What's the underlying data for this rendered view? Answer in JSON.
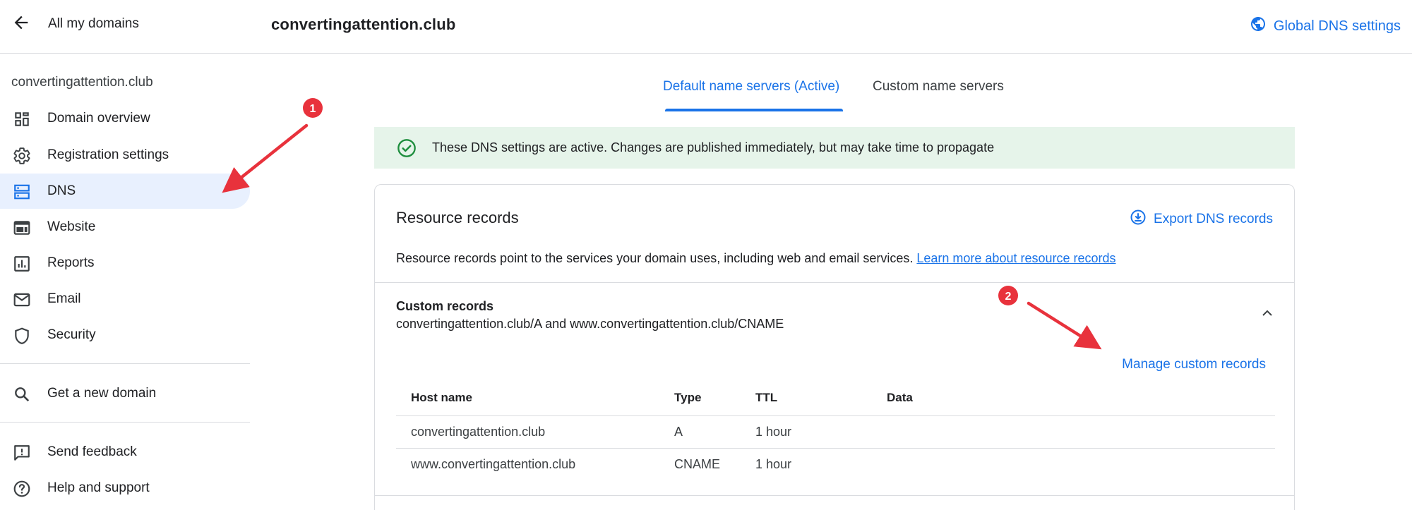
{
  "header": {
    "back_label": "All my domains",
    "domain": "convertingattention.club",
    "global_dns_label": "Global DNS settings"
  },
  "sidebar": {
    "domain": "convertingattention.club",
    "items": [
      {
        "label": "Domain overview",
        "icon": "dashboard-icon"
      },
      {
        "label": "Registration settings",
        "icon": "gear-icon"
      },
      {
        "label": "DNS",
        "icon": "dns-icon",
        "active": true
      },
      {
        "label": "Website",
        "icon": "web-icon"
      },
      {
        "label": "Reports",
        "icon": "bar-chart-icon"
      },
      {
        "label": "Email",
        "icon": "mail-icon"
      },
      {
        "label": "Security",
        "icon": "shield-icon"
      }
    ],
    "secondary": [
      {
        "label": "Get a new domain",
        "icon": "search-icon"
      }
    ],
    "footer": [
      {
        "label": "Send feedback",
        "icon": "feedback-icon"
      },
      {
        "label": "Help and support",
        "icon": "help-icon"
      }
    ]
  },
  "tabs": [
    {
      "label": "Default name servers (Active)",
      "active": true
    },
    {
      "label": "Custom name servers",
      "active": false
    }
  ],
  "banner": {
    "text": "These DNS settings are active. Changes are published immediately, but may take time to propagate"
  },
  "resource_records": {
    "title": "Resource records",
    "export_label": "Export DNS records",
    "description": "Resource records point to the services your domain uses, including web and email services.",
    "learn_more": "Learn more about resource records",
    "custom": {
      "title": "Custom records",
      "subtitle": "convertingattention.club/A and www.convertingattention.club/CNAME",
      "manage_label": "Manage custom records",
      "columns": [
        "Host name",
        "Type",
        "TTL",
        "Data"
      ],
      "rows": [
        [
          "convertingattention.club",
          "A",
          "1 hour",
          ""
        ],
        [
          "www.convertingattention.club",
          "CNAME",
          "1 hour",
          ""
        ]
      ]
    }
  },
  "annotations": [
    "1",
    "2"
  ],
  "colors": {
    "accent": "#1a73e8",
    "active_bg": "#e8f0fe",
    "banner_bg": "#e6f4ea",
    "success": "#1e8e3e",
    "annotation": "#e8323c"
  }
}
